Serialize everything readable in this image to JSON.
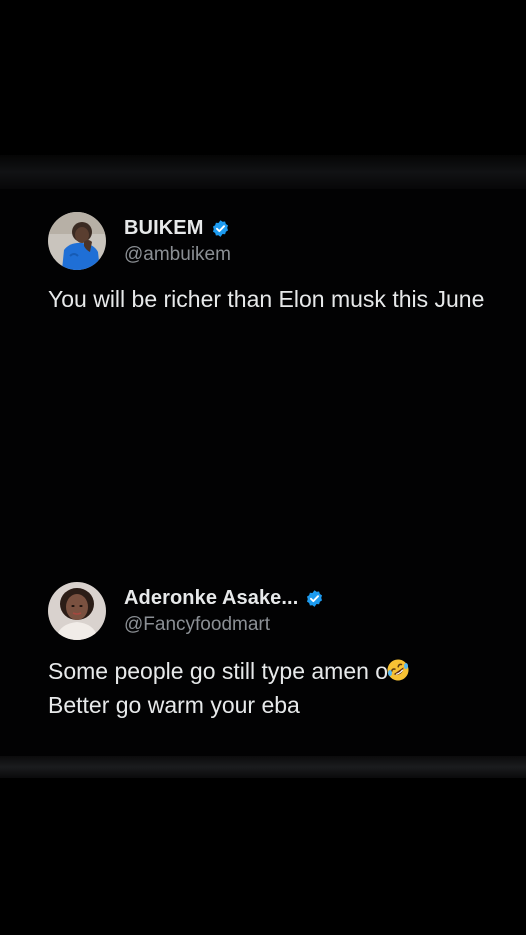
{
  "colors": {
    "background": "#000000",
    "text": "#e7e9ea",
    "handle": "#8b8f94",
    "verified": "#1d9bf0"
  },
  "tweets": [
    {
      "display_name": "BUIKEM",
      "handle": "@ambuikem",
      "verified": true,
      "avatar_icon": "profile-photo-man-blue-shirt",
      "text": "You will be richer than Elon musk this June"
    },
    {
      "display_name": "Aderonke Asake...",
      "handle": "@Fancyfoodmart",
      "verified": true,
      "avatar_icon": "profile-photo-woman",
      "text_line1": "Some people go still type amen o",
      "emoji": "rolling-on-floor-laughing-emoji",
      "text_line2": "Better go warm your eba"
    }
  ]
}
